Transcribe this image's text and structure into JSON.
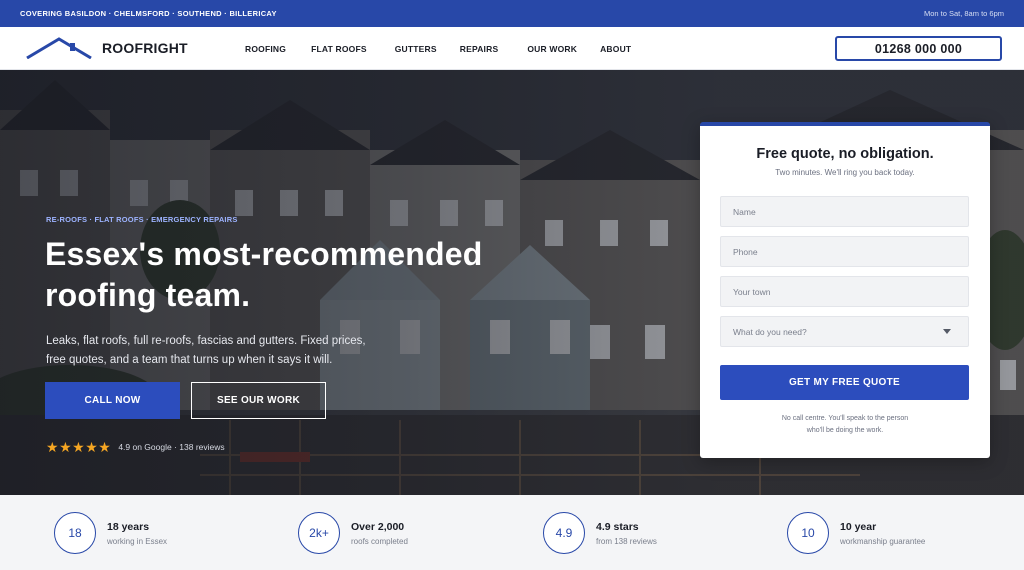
{
  "topbar": {
    "areas": "COVERING BASILDON · CHELMSFORD · SOUTHEND · BILLERICAY",
    "hours": "Mon to Sat, 8am to 6pm"
  },
  "header": {
    "logo_text": "ROOFRIGHT",
    "nav": [
      "ROOFING",
      "FLAT ROOFS",
      "GUTTERS",
      "REPAIRS",
      "OUR WORK",
      "ABOUT"
    ],
    "phone": "01268 000 000"
  },
  "hero": {
    "eyebrow": "RE-ROOFS · FLAT ROOFS · EMERGENCY REPAIRS",
    "headline": "Essex's most-recommended roofing team.",
    "subcopy": "Leaks, flat roofs, full re-roofs, fascias and gutters. Fixed prices, free quotes, and a team that turns up when it says it will.",
    "call_button": "CALL NOW",
    "work_button": "SEE OUR WORK",
    "rating_stars": 5,
    "rating_text": "4.9 on Google · 138 reviews"
  },
  "quote_form": {
    "title": "Free quote, no obligation.",
    "subtitle": "Two minutes. We'll ring you back today.",
    "name_placeholder": "Name",
    "phone_placeholder": "Phone",
    "town_placeholder": "Your town",
    "service_select": "What do you need?",
    "submit_label": "GET MY FREE QUOTE",
    "note_line1": "No call centre. You'll speak to the person",
    "note_line2": "who'll be doing the work."
  },
  "stats": [
    {
      "badge": "18",
      "title": "18 years",
      "sub": "working in Essex"
    },
    {
      "badge": "2k+",
      "title": "Over 2,000",
      "sub": "roofs completed"
    },
    {
      "badge": "4.9",
      "title": "4.9 stars",
      "sub": "from 138 reviews"
    },
    {
      "badge": "10",
      "title": "10 year",
      "sub": "workmanship guarantee"
    }
  ],
  "colors": {
    "brand_blue": "#2848a8",
    "button_blue": "#2c4dbd",
    "eyebrow_blue": "#9db3ff",
    "star_gold": "#f5a623"
  }
}
